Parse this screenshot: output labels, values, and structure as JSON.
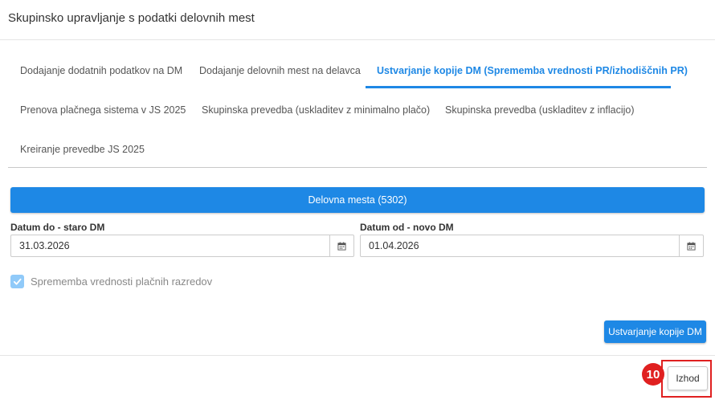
{
  "dialog": {
    "title": "Skupinsko upravljanje s podatki delovnih mest"
  },
  "tabs": [
    {
      "label": "Dodajanje dodatnih podatkov na DM",
      "active": false
    },
    {
      "label": "Dodajanje delovnih mest na delavca",
      "active": false
    },
    {
      "label": "Ustvarjanje kopije DM (Sprememba vrednosti PR/izhodiščnih PR)",
      "active": true
    },
    {
      "label": "Prenova plačnega sistema v JS 2025",
      "active": false
    },
    {
      "label": "Skupinska prevedba (uskladitev z minimalno plačo)",
      "active": false
    },
    {
      "label": "Skupinska prevedba (uskladitev z inflacijo)",
      "active": false
    },
    {
      "label": "Kreiranje prevedbe JS 2025",
      "active": false
    }
  ],
  "workplaces_button": {
    "label": "Delovna mesta (5302)"
  },
  "date_to": {
    "label": "Datum do - staro DM",
    "value": "31.03.2026"
  },
  "date_from": {
    "label": "Datum od - novo DM",
    "value": "01.04.2026"
  },
  "pay_grade_change": {
    "label": "Sprememba vrednosti plačnih razredov",
    "checked": true
  },
  "create_copy_button": {
    "label": "Ustvarjanje kopije DM"
  },
  "exit_button": {
    "label": "Izhod"
  },
  "step_marker": {
    "label": "10"
  },
  "colors": {
    "accent": "#1e88e5",
    "highlight": "#e02020",
    "checkbox": "#90caf9"
  },
  "icons": {
    "calendar": "calendar-icon",
    "check": "check-icon"
  }
}
